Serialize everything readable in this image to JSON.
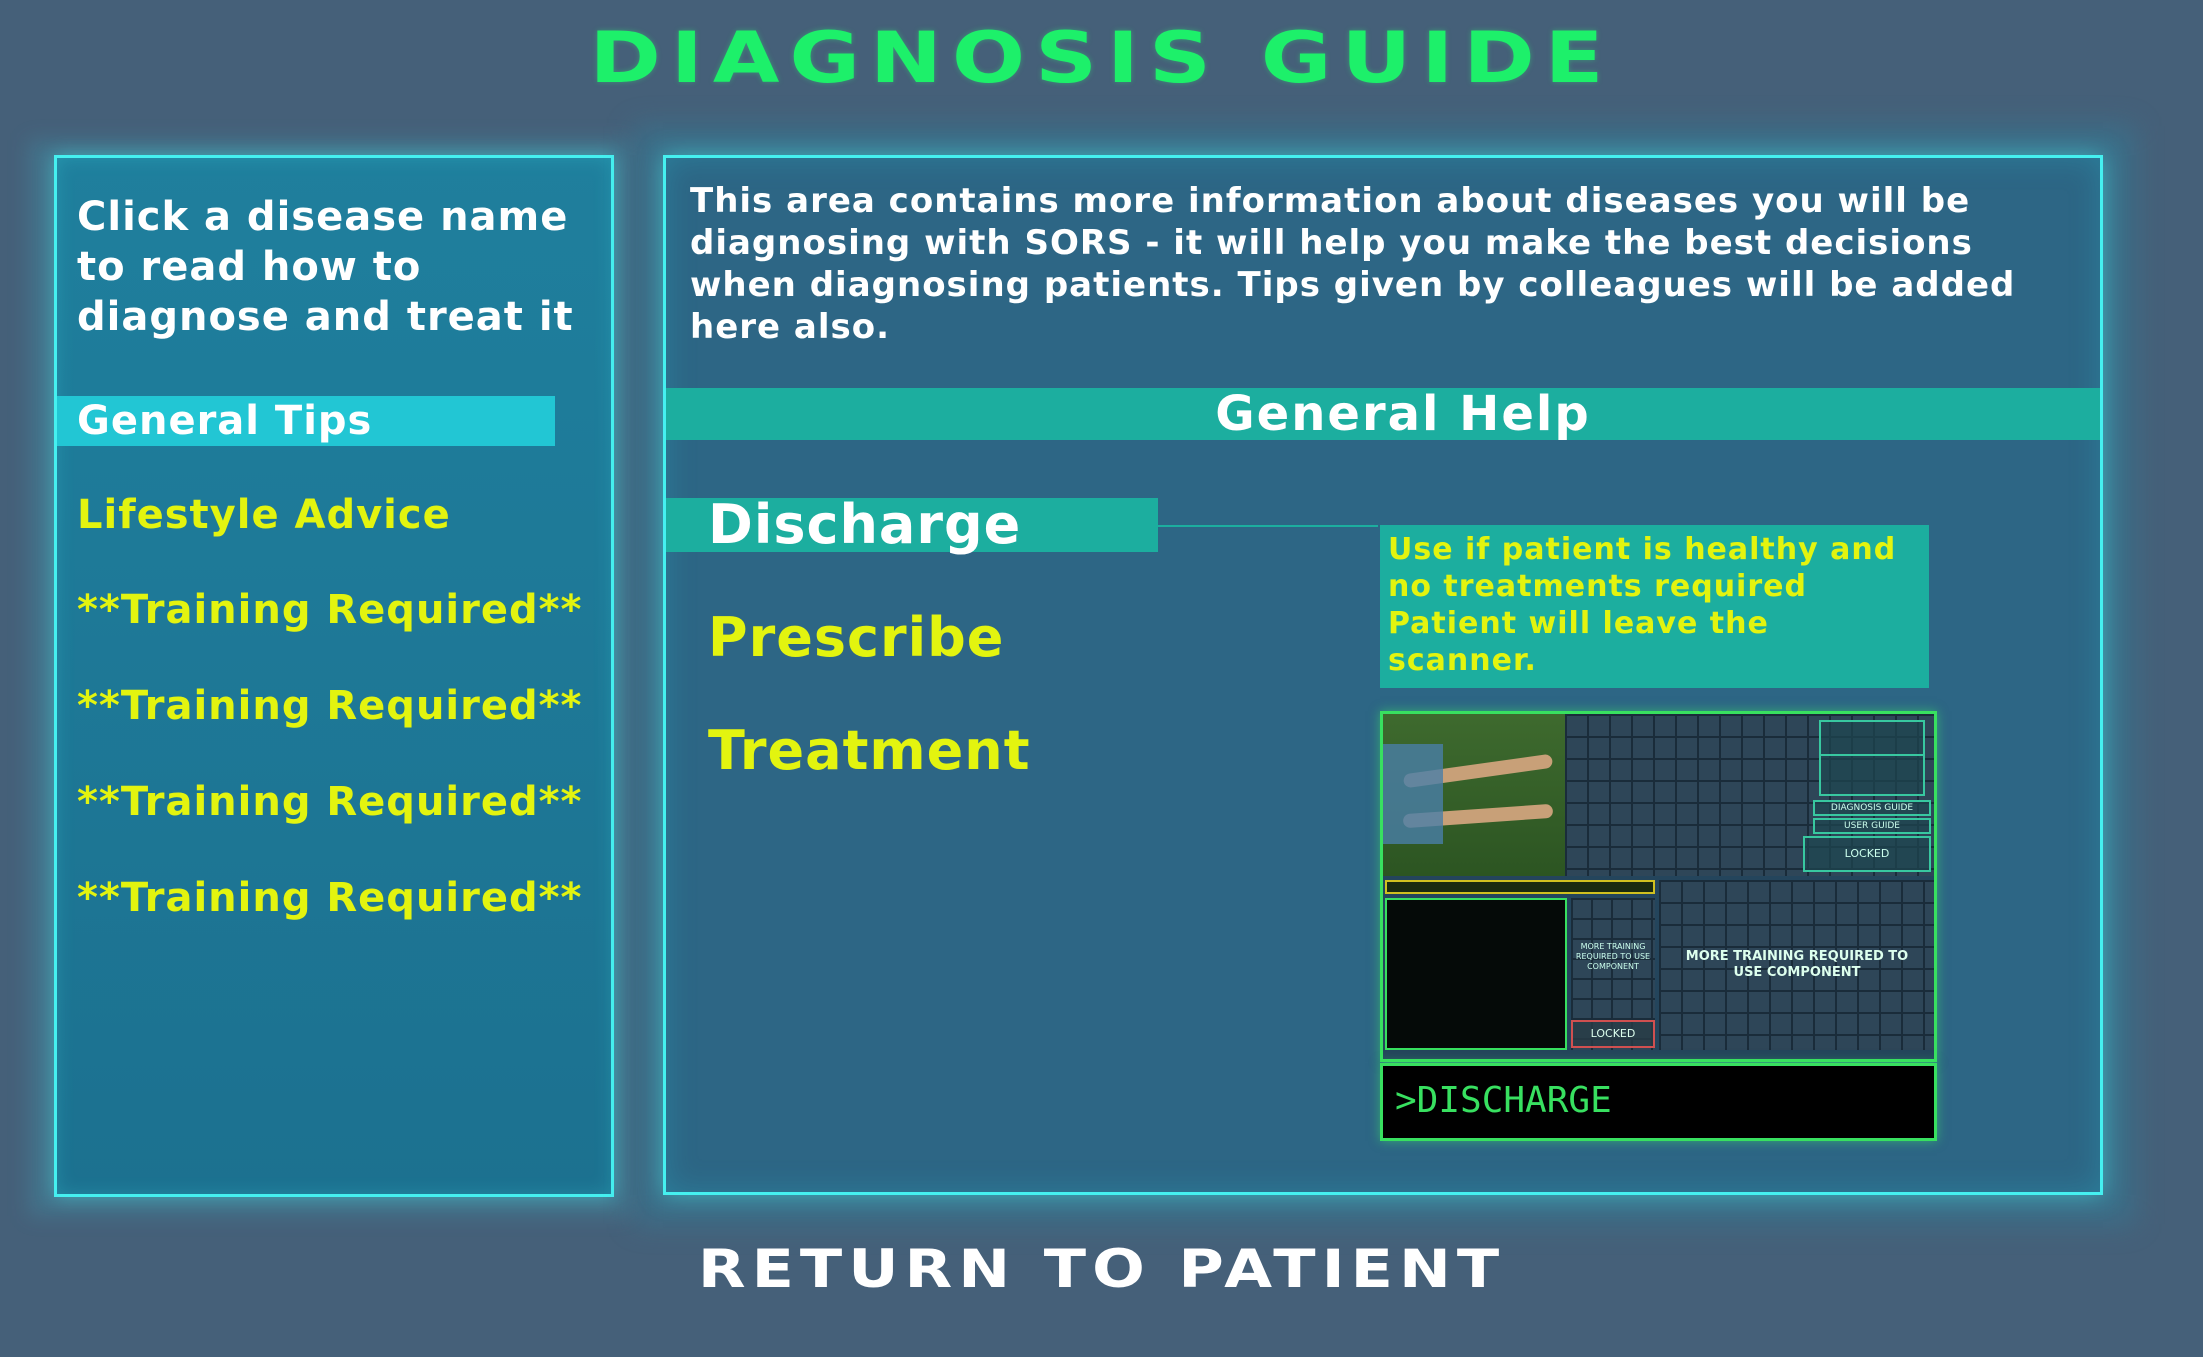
{
  "title": "DIAGNOSIS GUIDE",
  "left": {
    "intro": "Click a disease name to read how to diagnose and treat it",
    "items": [
      {
        "label": "General Tips"
      },
      {
        "label": "Lifestyle Advice"
      },
      {
        "label": "**Training Required**"
      },
      {
        "label": "**Training Required**"
      },
      {
        "label": "**Training Required**"
      },
      {
        "label": "**Training Required**"
      }
    ]
  },
  "right": {
    "intro": "This area contains more information about diseases you will be diagnosing with SORS - it will help you make the best decisions when diagnosing patients. Tips given by colleagues will be added here also.",
    "section_title": "General Help",
    "actions": [
      {
        "label": "Discharge"
      },
      {
        "label": "Prescribe"
      },
      {
        "label": "Treatment"
      }
    ],
    "description": "Use if patient is healthy and no treatments required Patient will leave the scanner.",
    "preview": {
      "top_button_1": "DIAGNOSIS GUIDE",
      "top_button_2": "USER GUIDE",
      "locked_label": "LOCKED",
      "training_label": "MORE TRAINING REQUIRED TO USE COMPONENT",
      "small_training_label": "MORE TRAINING REQUIRED TO USE COMPONENT",
      "console_text": ">DISCHARGE"
    }
  },
  "return_label": "RETURN TO PATIENT",
  "colors": {
    "background": "#456079",
    "title_green": "#1df06a",
    "highlight_yellow": "#e3f40f",
    "panel_border": "#45f0f0",
    "section_teal": "#1cae9f",
    "active_item": "#22c6d4"
  }
}
